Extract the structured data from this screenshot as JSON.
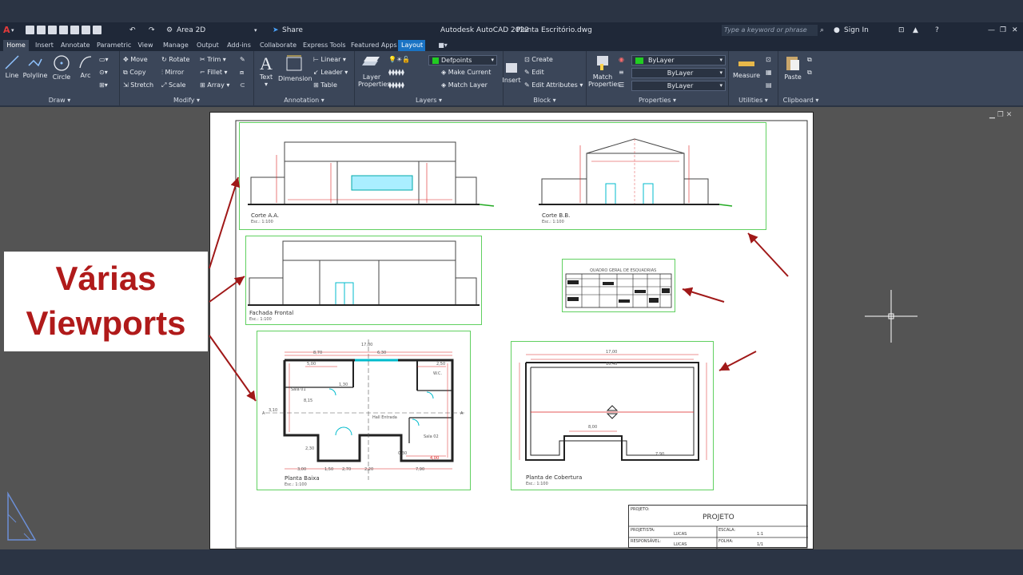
{
  "app": {
    "title": "Autodesk AutoCAD 2022",
    "filename": "Planta Escritório.dwg",
    "workspace": "Area 2D",
    "share_label": "Share",
    "search_placeholder": "Type a keyword or phrase",
    "sign_in": "Sign In",
    "logo": "A"
  },
  "tabs": [
    {
      "label": "Home"
    },
    {
      "label": "Insert"
    },
    {
      "label": "Annotate"
    },
    {
      "label": "Parametric"
    },
    {
      "label": "View"
    },
    {
      "label": "Manage"
    },
    {
      "label": "Output"
    },
    {
      "label": "Add-ins"
    },
    {
      "label": "Collaborate"
    },
    {
      "label": "Express Tools"
    },
    {
      "label": "Featured Apps"
    },
    {
      "label": "Layout"
    }
  ],
  "ribbon": {
    "draw": {
      "title": "Draw",
      "line": "Line",
      "polyline": "Polyline",
      "circle": "Circle",
      "arc": "Arc"
    },
    "modify": {
      "title": "Modify",
      "move": "Move",
      "rotate": "Rotate",
      "trim": "Trim",
      "copy": "Copy",
      "mirror": "Mirror",
      "fillet": "Fillet",
      "stretch": "Stretch",
      "scale": "Scale",
      "array": "Array"
    },
    "annotation": {
      "title": "Annotation",
      "text": "Text",
      "dimension": "Dimension",
      "linear": "Linear",
      "leader": "Leader",
      "table": "Table"
    },
    "layers": {
      "title": "Layers",
      "layer_properties_1": "Layer",
      "layer_properties_2": "Properties",
      "current_layer": "Defpoints",
      "make_current": "Make Current",
      "match_layer": "Match Layer"
    },
    "block": {
      "title": "Block",
      "insert": "Insert",
      "create": "Create",
      "edit": "Edit",
      "edit_attributes": "Edit Attributes"
    },
    "properties": {
      "title": "Properties",
      "match_1": "Match",
      "match_2": "Properties",
      "color": "ByLayer",
      "linetype": "ByLayer",
      "lineweight": "ByLayer"
    },
    "utilities": {
      "title": "Utilities",
      "measure": "Measure"
    },
    "clipboard": {
      "title": "Clipboard",
      "paste": "Paste"
    }
  },
  "viewports": {
    "corte_aa": {
      "label": "Corte A.A.",
      "scale": "Esc.: 1:100"
    },
    "corte_bb": {
      "label": "Corte B.B.",
      "scale": "Esc.: 1:100"
    },
    "fachada": {
      "label": "Fachada Frontal",
      "scale": "Esc.: 1:100"
    },
    "quadro": {
      "title": "QUADRO GERAL DE ESQUADRIAS"
    },
    "planta_baixa": {
      "label": "Planta Baixa",
      "scale": "Esc.: 1:100",
      "rooms": [
        "Sala 01",
        "W.C.",
        "Hall Entrada",
        "Sala 02"
      ],
      "dims": [
        "17,00",
        "8,70",
        "6,30",
        "5,00",
        "2,50",
        "8,15",
        "1,30",
        "2,30",
        "0,30",
        "4,00",
        "3,00",
        "1,50",
        "2,70",
        "7,90",
        "2,20",
        "3,10"
      ],
      "section_mark": "A"
    },
    "cobertura": {
      "label": "Planta de Cobertura",
      "scale": "Esc.: 1:100",
      "dims": [
        "17,00",
        "16,40",
        "8,00",
        "7,90"
      ]
    }
  },
  "title_block": {
    "projeto_label": "PROJETO:",
    "projeto_value": "PROJETO",
    "projetista_label": "PROJETISTA:",
    "projetista_value": "LUCAS",
    "escala_label": "ESCALA:",
    "escala_value": "1:1",
    "responsavel_label": "RESPONSÁVEL:",
    "responsavel_value": "LUCAS",
    "folha_label": "FOLHA:",
    "folha_value": "1/1"
  },
  "callout": {
    "line1": "Várias",
    "line2": "Viewports"
  },
  "colors": {
    "accent": "#1a73c4",
    "viewport_border": "#60d060",
    "arrow": "#a01818",
    "callout_text": "#b01a1a",
    "layer_swatch": "#22cc22"
  }
}
